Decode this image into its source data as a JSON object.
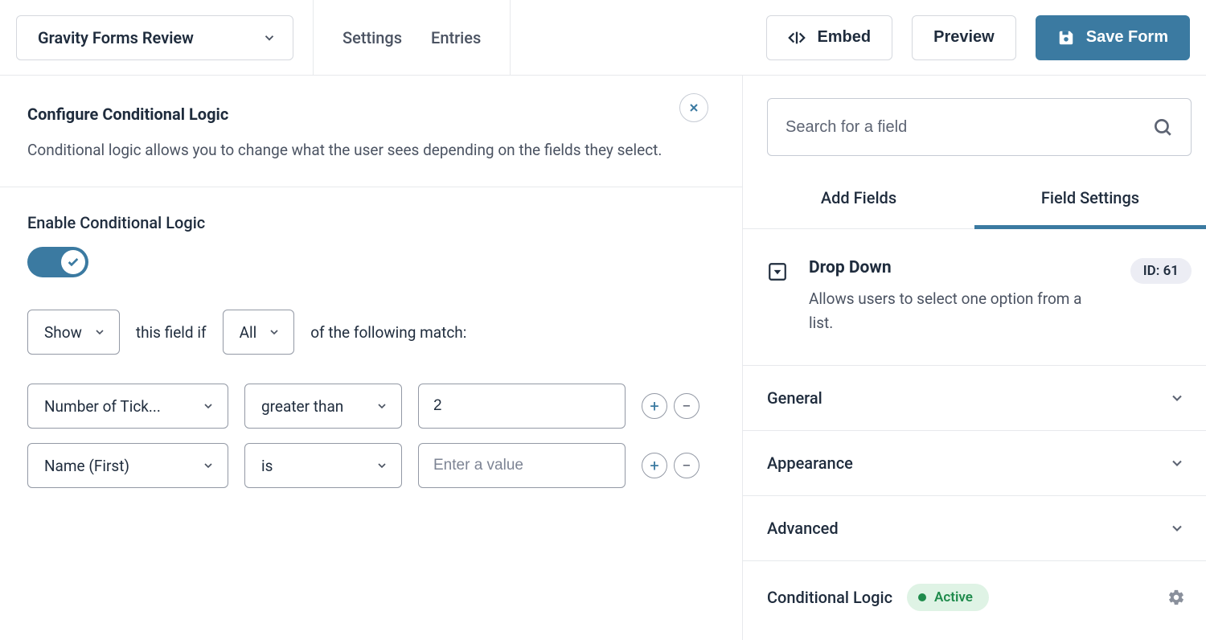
{
  "header": {
    "form_select": "Gravity Forms Review",
    "nav": {
      "settings": "Settings",
      "entries": "Entries"
    },
    "actions": {
      "embed": "Embed",
      "preview": "Preview",
      "save": "Save Form"
    }
  },
  "config": {
    "title": "Configure Conditional Logic",
    "desc": "Conditional logic allows you to change what the user sees depending on the fields they select."
  },
  "enable": {
    "label": "Enable Conditional Logic",
    "state": "on"
  },
  "sentence": {
    "show": "Show",
    "text1": "this field if",
    "match": "All",
    "text2": "of the following match:"
  },
  "rows": [
    {
      "field": "Number of Tick...",
      "op": "greater than",
      "value": "2",
      "placeholder": ""
    },
    {
      "field": "Name (First)",
      "op": "is",
      "value": "",
      "placeholder": "Enter a value"
    }
  ],
  "sidebar": {
    "search_placeholder": "Search for a field",
    "tabs": {
      "add": "Add Fields",
      "settings": "Field Settings"
    },
    "field": {
      "title": "Drop Down",
      "desc": "Allows users to select one option from a list.",
      "id_label": "ID: 61"
    },
    "accordion": {
      "general": "General",
      "appearance": "Appearance",
      "advanced": "Advanced",
      "cond": "Conditional Logic",
      "active": "Active"
    }
  }
}
